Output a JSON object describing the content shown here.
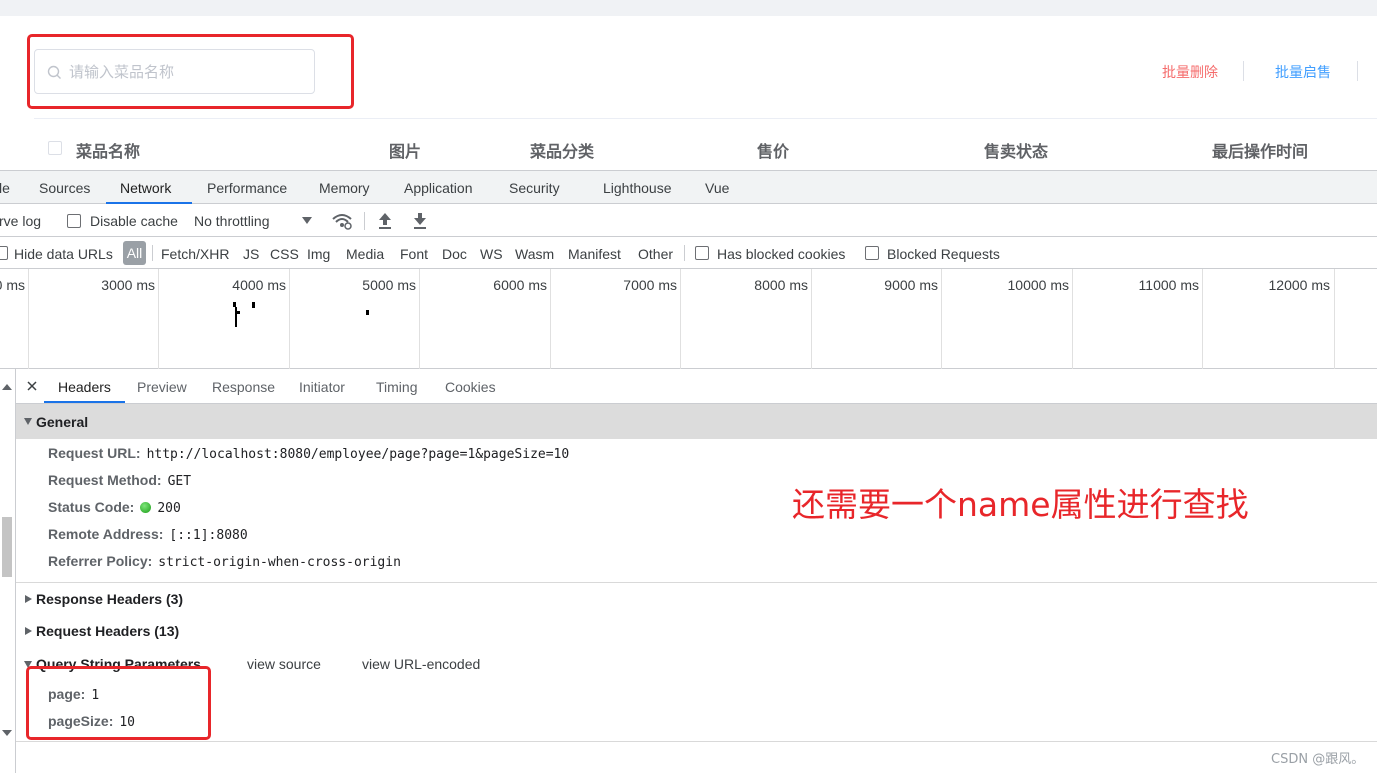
{
  "app": {
    "search": {
      "placeholder": "请输入菜品名称",
      "value": ""
    },
    "actions": {
      "batch_delete": "批量删除",
      "batch_start": "批量启售"
    },
    "table_headers": [
      "菜品名称",
      "图片",
      "菜品分类",
      "售价",
      "售卖状态",
      "最后操作时间"
    ],
    "colors": {
      "danger": "#f56c6c",
      "primary": "#409eff",
      "annotation": "#e8262a"
    }
  },
  "devtools": {
    "tabs": [
      "le",
      "Sources",
      "Network",
      "Performance",
      "Memory",
      "Application",
      "Security",
      "Lighthouse",
      "Vue"
    ],
    "active_tab": "Network",
    "toolbar": {
      "preserve_log": "rve log",
      "disable_cache": "Disable cache",
      "throttling": "No throttling"
    },
    "filters": {
      "hide_data_urls": "Hide data URLs",
      "all": "All",
      "types": [
        "Fetch/XHR",
        "JS",
        "CSS",
        "Img",
        "Media",
        "Font",
        "Doc",
        "WS",
        "Wasm",
        "Manifest",
        "Other"
      ],
      "has_blocked_cookies": "Has blocked cookies",
      "blocked_requests": "Blocked Requests"
    },
    "timeline_labels": [
      "0 ms",
      "3000 ms",
      "4000 ms",
      "5000 ms",
      "6000 ms",
      "7000 ms",
      "8000 ms",
      "9000 ms",
      "10000 ms",
      "11000 ms",
      "12000 ms"
    ],
    "detail_tabs": [
      "Headers",
      "Preview",
      "Response",
      "Initiator",
      "Timing",
      "Cookies"
    ],
    "active_detail_tab": "Headers",
    "general": {
      "title": "General",
      "request_url_label": "Request URL:",
      "request_url": "http://localhost:8080/employee/page?page=1&pageSize=10",
      "request_method_label": "Request Method:",
      "request_method": "GET",
      "status_code_label": "Status Code:",
      "status_code": "200",
      "remote_address_label": "Remote Address:",
      "remote_address": "[::1]:8080",
      "referrer_policy_label": "Referrer Policy:",
      "referrer_policy": "strict-origin-when-cross-origin"
    },
    "response_headers": "Response Headers (3)",
    "request_headers": "Request Headers (13)",
    "query_params": {
      "title": "Query String Parameters",
      "view_source": "view source",
      "view_url_encoded": "view URL-encoded",
      "page_label": "page:",
      "page_value": "1",
      "page_size_label": "pageSize:",
      "page_size_value": "10"
    }
  },
  "annotation": "还需要一个name属性进行查找",
  "watermark": "CSDN @跟风。"
}
